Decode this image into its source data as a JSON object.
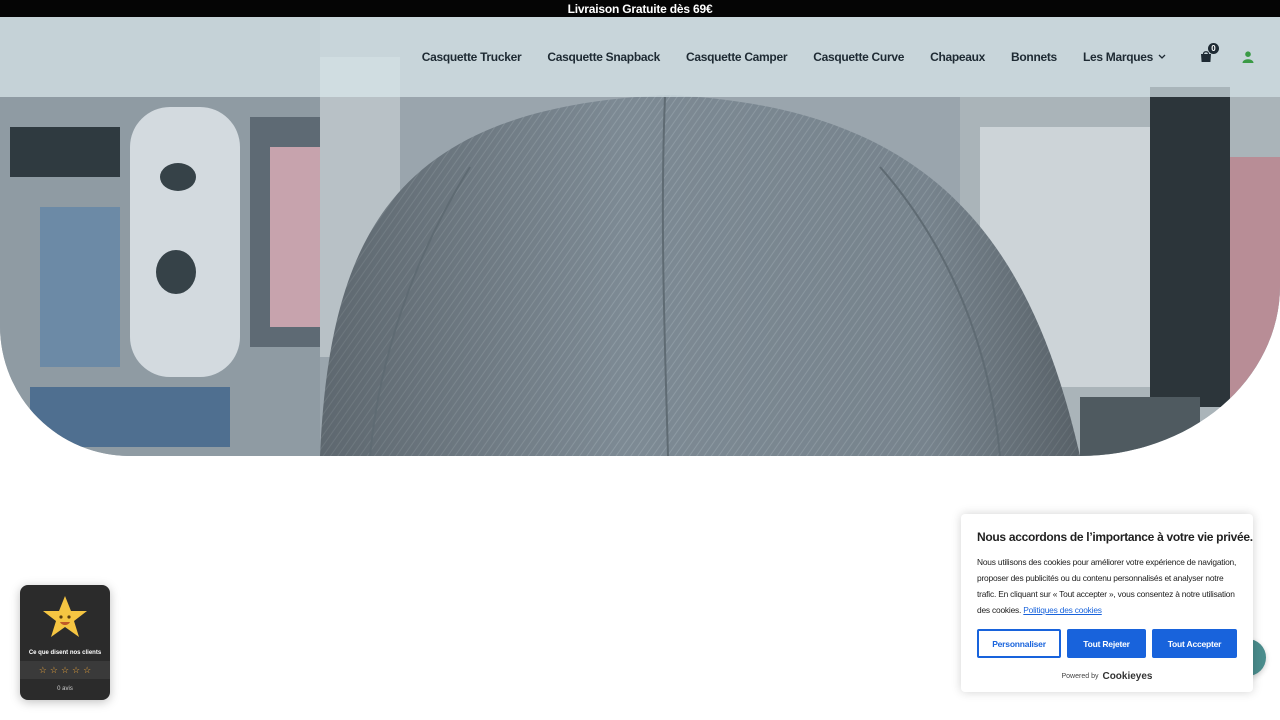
{
  "announcement": {
    "text": "Livraison Gratuite dès 69€"
  },
  "nav": {
    "items": [
      {
        "label": "Casquette Trucker"
      },
      {
        "label": "Casquette Snapback"
      },
      {
        "label": "Casquette Camper"
      },
      {
        "label": "Casquette Curve"
      },
      {
        "label": "Chapeaux"
      },
      {
        "label": "Bonnets"
      },
      {
        "label": "Les Marques"
      }
    ],
    "cart_count": "0",
    "icons": {
      "cart": "shopping-bag-icon",
      "account": "user-icon",
      "dropdown": "chevron-down-icon"
    }
  },
  "reviews": {
    "caption": "Ce que disent nos clients",
    "count_label": "0 avis",
    "rating": 0,
    "max_rating": 5,
    "icon": "star-smile-icon"
  },
  "cookie_banner": {
    "title": "Nous accordons de l’importance à votre vie privée.",
    "body": "Nous utilisons des cookies pour améliorer votre expérience de navigation, proposer des publicités ou du contenu personnalisés et analyser notre trafic. En cliquant sur « Tout accepter », vous consentez à notre utilisation des cookies.",
    "policy_link": "Politiques des cookies",
    "buttons": {
      "customize": "Personnaliser",
      "reject": "Tout Rejeter",
      "accept": "Tout Accepter"
    },
    "powered_by": "Powered by",
    "brand": "Cookieyes"
  },
  "colors": {
    "accent": "#1863dc",
    "topbar": "#050505",
    "header_overlay": "#dae8ec",
    "nav_text": "#1e2a33",
    "user_icon": "#3a9a45"
  }
}
